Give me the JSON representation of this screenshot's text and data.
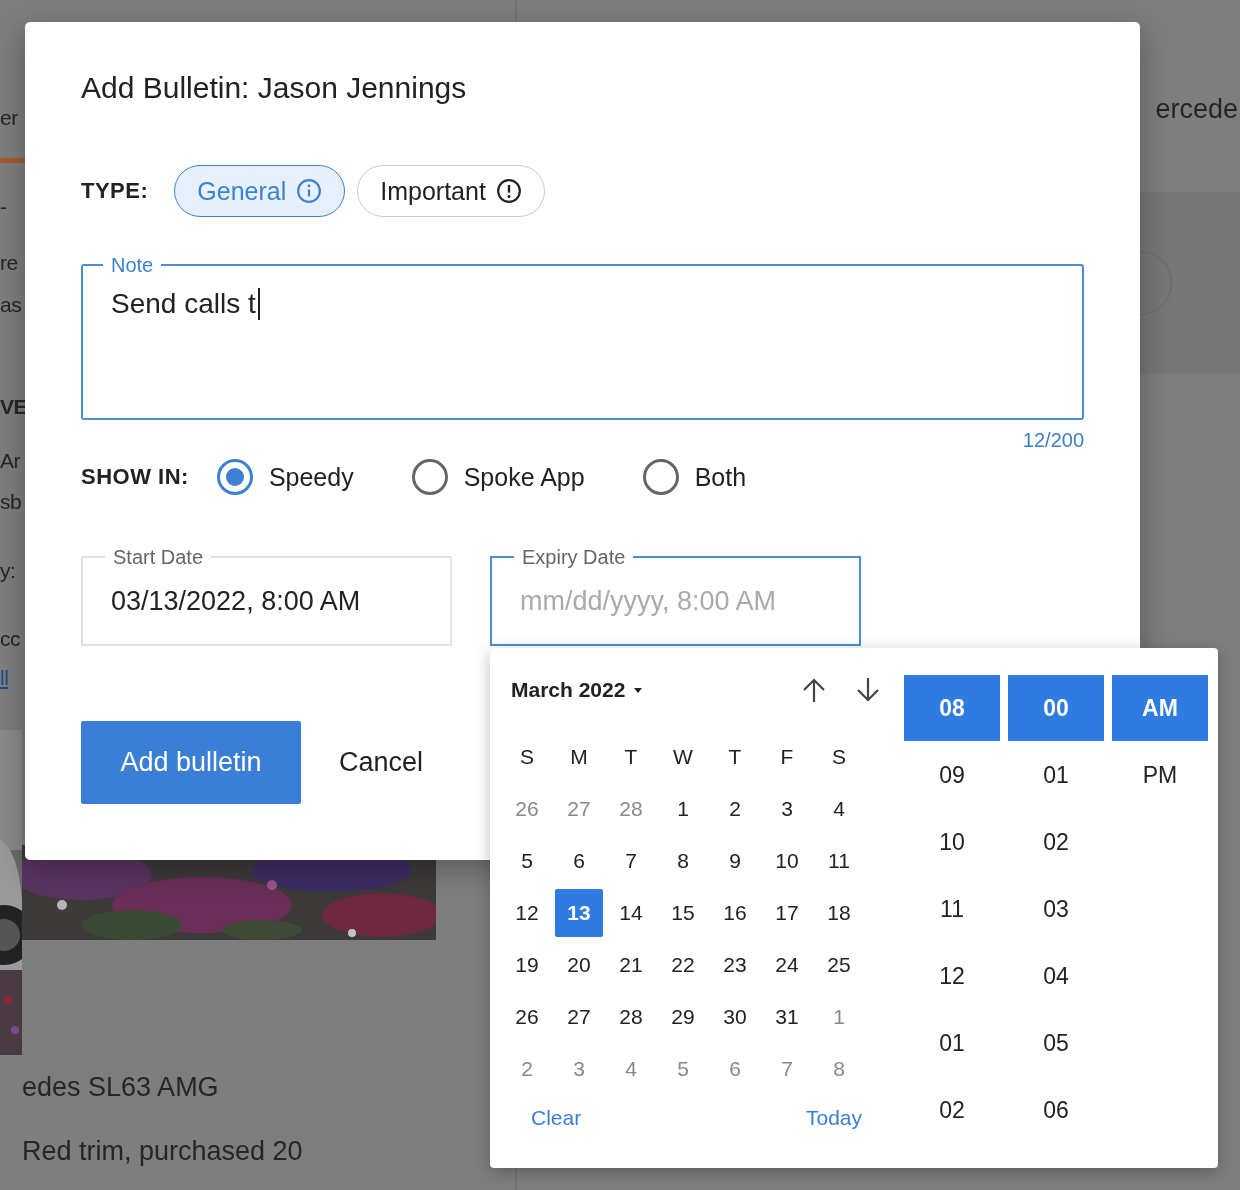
{
  "background": {
    "tab_label": "er",
    "fragments": [
      {
        "text": "-",
        "kind": "text"
      },
      {
        "text": "re",
        "kind": "text"
      },
      {
        "text": "as",
        "kind": "text"
      },
      {
        "text": "VE",
        "kind": "heading"
      },
      {
        "text": "Ar",
        "kind": "text"
      },
      {
        "text": "sb",
        "kind": "text"
      },
      {
        "text": "y:",
        "kind": "text"
      },
      {
        "text": "cc",
        "kind": "text"
      },
      {
        "text": "ll",
        "kind": "link"
      }
    ],
    "right_title": "ercede",
    "card_title": "edes SL63 AMG",
    "card_text": "Red trim, purchased 20"
  },
  "dialog": {
    "title": "Add Bulletin: Jason Jennings",
    "type_label": "TYPE:",
    "types": [
      {
        "label": "General",
        "kind": "info",
        "selected": true
      },
      {
        "label": "Important",
        "kind": "alert",
        "selected": false
      }
    ],
    "note": {
      "label": "Note",
      "value": "Send calls t",
      "focused": true,
      "counter": "12/200"
    },
    "show_in_label": "SHOW IN:",
    "show_in": [
      {
        "label": "Speedy",
        "selected": true
      },
      {
        "label": "Spoke App",
        "selected": false
      },
      {
        "label": "Both",
        "selected": false
      }
    ],
    "start_date": {
      "label": "Start Date",
      "value": "03/13/2022, 8:00 AM",
      "focused": false
    },
    "expiry_date": {
      "label": "Expiry Date",
      "placeholder": "mm/dd/yyyy, 8:00 AM",
      "focused": true
    },
    "buttons": [
      {
        "label": "Add bulletin",
        "kind": "primary"
      },
      {
        "label": "Cancel",
        "kind": "text"
      }
    ]
  },
  "date_picker": {
    "month": "March 2022",
    "weekdays": [
      "S",
      "M",
      "T",
      "W",
      "T",
      "F",
      "S"
    ],
    "weeks": [
      [
        {
          "day": "26",
          "muted": true,
          "selected": false
        },
        {
          "day": "27",
          "muted": true,
          "selected": false
        },
        {
          "day": "28",
          "muted": true,
          "selected": false
        },
        {
          "day": "1",
          "muted": false,
          "selected": false
        },
        {
          "day": "2",
          "muted": false,
          "selected": false
        },
        {
          "day": "3",
          "muted": false,
          "selected": false
        },
        {
          "day": "4",
          "muted": false,
          "selected": false
        }
      ],
      [
        {
          "day": "5",
          "muted": false,
          "selected": false
        },
        {
          "day": "6",
          "muted": false,
          "selected": false
        },
        {
          "day": "7",
          "muted": false,
          "selected": false
        },
        {
          "day": "8",
          "muted": false,
          "selected": false
        },
        {
          "day": "9",
          "muted": false,
          "selected": false
        },
        {
          "day": "10",
          "muted": false,
          "selected": false
        },
        {
          "day": "11",
          "muted": false,
          "selected": false
        }
      ],
      [
        {
          "day": "12",
          "muted": false,
          "selected": false
        },
        {
          "day": "13",
          "muted": false,
          "selected": true
        },
        {
          "day": "14",
          "muted": false,
          "selected": false
        },
        {
          "day": "15",
          "muted": false,
          "selected": false
        },
        {
          "day": "16",
          "muted": false,
          "selected": false
        },
        {
          "day": "17",
          "muted": false,
          "selected": false
        },
        {
          "day": "18",
          "muted": false,
          "selected": false
        }
      ],
      [
        {
          "day": "19",
          "muted": false,
          "selected": false
        },
        {
          "day": "20",
          "muted": false,
          "selected": false
        },
        {
          "day": "21",
          "muted": false,
          "selected": false
        },
        {
          "day": "22",
          "muted": false,
          "selected": false
        },
        {
          "day": "23",
          "muted": false,
          "selected": false
        },
        {
          "day": "24",
          "muted": false,
          "selected": false
        },
        {
          "day": "25",
          "muted": false,
          "selected": false
        }
      ],
      [
        {
          "day": "26",
          "muted": false,
          "selected": false
        },
        {
          "day": "27",
          "muted": false,
          "selected": false
        },
        {
          "day": "28",
          "muted": false,
          "selected": false
        },
        {
          "day": "29",
          "muted": false,
          "selected": false
        },
        {
          "day": "30",
          "muted": false,
          "selected": false
        },
        {
          "day": "31",
          "muted": false,
          "selected": false
        },
        {
          "day": "1",
          "muted": true,
          "selected": false
        }
      ],
      [
        {
          "day": "2",
          "muted": true,
          "selected": false
        },
        {
          "day": "3",
          "muted": true,
          "selected": false
        },
        {
          "day": "4",
          "muted": true,
          "selected": false
        },
        {
          "day": "5",
          "muted": true,
          "selected": false
        },
        {
          "day": "6",
          "muted": true,
          "selected": false
        },
        {
          "day": "7",
          "muted": true,
          "selected": false
        },
        {
          "day": "8",
          "muted": true,
          "selected": false
        }
      ]
    ],
    "hours": [
      {
        "label": "08",
        "selected": true
      },
      {
        "label": "09",
        "selected": false
      },
      {
        "label": "10",
        "selected": false
      },
      {
        "label": "11",
        "selected": false
      },
      {
        "label": "12",
        "selected": false
      },
      {
        "label": "01",
        "selected": false
      },
      {
        "label": "02",
        "selected": false
      }
    ],
    "minutes": [
      {
        "label": "00",
        "selected": true
      },
      {
        "label": "01",
        "selected": false
      },
      {
        "label": "02",
        "selected": false
      },
      {
        "label": "03",
        "selected": false
      },
      {
        "label": "04",
        "selected": false
      },
      {
        "label": "05",
        "selected": false
      },
      {
        "label": "06",
        "selected": false
      }
    ],
    "periods": [
      {
        "label": "AM",
        "selected": true
      },
      {
        "label": "PM",
        "selected": false
      }
    ],
    "clear": "Clear",
    "today": "Today"
  }
}
